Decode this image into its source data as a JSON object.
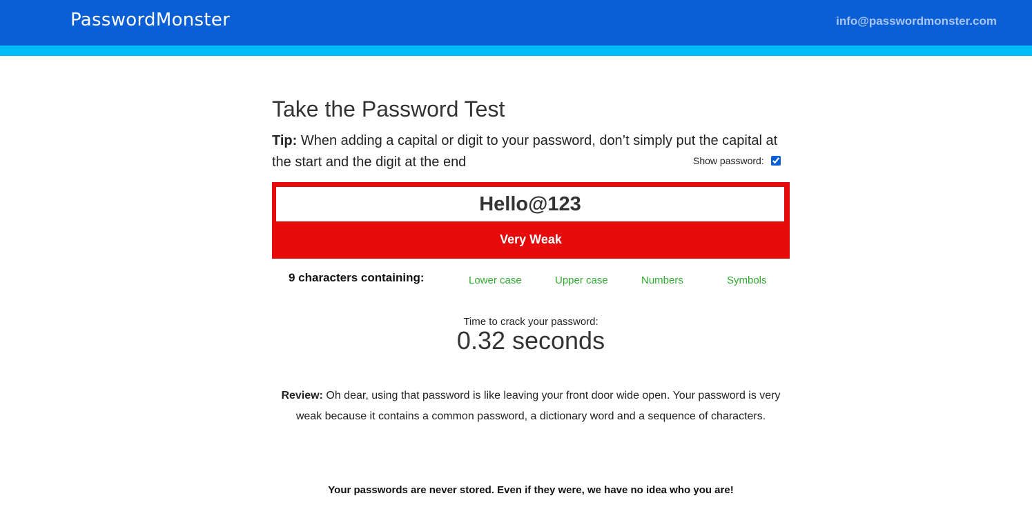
{
  "header": {
    "logo": "PasswordMonster",
    "email": "info@passwordmonster.com"
  },
  "main": {
    "title": "Take the Password Test",
    "tip_label": "Tip:",
    "tip_text": " When adding a capital or digit to your password, don’t simply put the capital at the start and the digit at the end",
    "show_password_label": "Show password:",
    "show_password_checked": true,
    "password_value": "Hello@123",
    "strength": "Very Weak",
    "strength_color": "#e60a0a",
    "char_summary": "9 characters containing:",
    "char_types": [
      "Lower case",
      "Upper case",
      "Numbers",
      "Symbols"
    ],
    "char_type_color": "#2eaa2e",
    "crack_caption": "Time to crack your password:",
    "crack_time": "0.32 seconds",
    "review_label": "Review:",
    "review_text": " Oh dear, using that password is like leaving your front door wide open. Your password is very weak because it contains a common password, a dictionary word and a sequence of characters.",
    "privacy_note": "Your passwords are never stored. Even if they were, we have no idea who you are!"
  },
  "colors": {
    "header": "#0b5fd6",
    "header_stripe": "#00bdf7"
  }
}
